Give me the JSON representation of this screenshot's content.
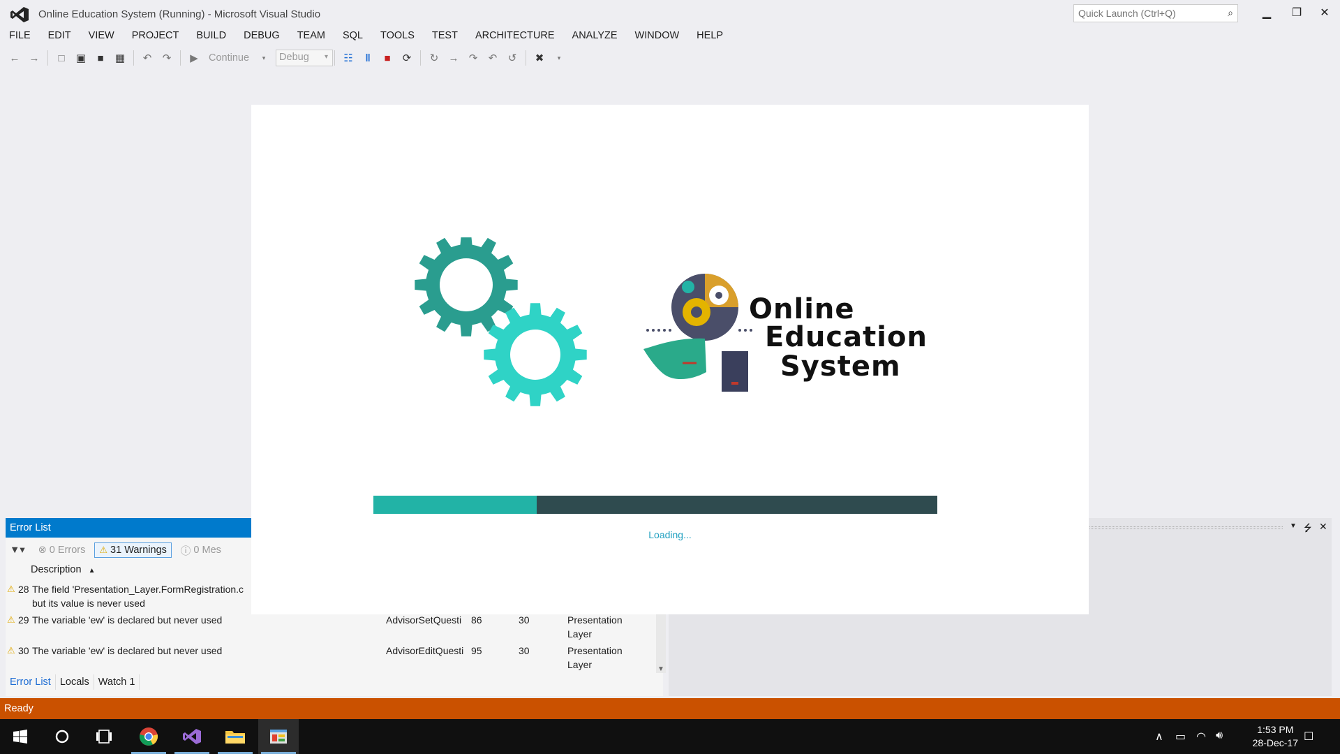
{
  "window": {
    "title": "Online Education System (Running) - Microsoft Visual Studio",
    "quick_launch_placeholder": "Quick Launch (Ctrl+Q)",
    "minimize": "▁",
    "restore": "❐",
    "close": "✕"
  },
  "menu": [
    "FILE",
    "EDIT",
    "VIEW",
    "PROJECT",
    "BUILD",
    "DEBUG",
    "TEAM",
    "SQL",
    "TOOLS",
    "TEST",
    "ARCHITECTURE",
    "ANALYZE",
    "WINDOW",
    "HELP"
  ],
  "toolbar": {
    "continue_label": "Continue",
    "config_value": "Debug"
  },
  "splash": {
    "logo_line1": "Online",
    "logo_line2": "Education",
    "logo_line3": "System",
    "progress_fraction": 0.29,
    "loading_text": "Loading...",
    "colors": {
      "gear_dark": "#2a9d8f",
      "gear_light": "#2fd3c6",
      "progress_fill": "#22b3a6",
      "progress_track": "#2f4b4f"
    }
  },
  "error_list": {
    "title": "Error List",
    "errors_label": "0 Errors",
    "warnings_label": "31 Warnings",
    "messages_label": "0 Mes",
    "column_description": "Description",
    "rows": [
      {
        "num": "28",
        "description": "The field 'Presentation_Layer.FormRegistration.c",
        "description2": "but its value is never used",
        "file": "",
        "line": "",
        "column": "",
        "project": "",
        "project2": ""
      },
      {
        "num": "29",
        "description": "The variable 'ew' is declared but never used",
        "description2": "",
        "file": "AdvisorSetQuesti",
        "line": "86",
        "column": "30",
        "project": "Presentation",
        "project2": "Layer"
      },
      {
        "num": "30",
        "description": "The variable 'ew' is declared but never used",
        "description2": "",
        "file": "AdvisorEditQuesti",
        "line": "95",
        "column": "30",
        "project": "Presentation",
        "project2": "Layer"
      }
    ],
    "tabs": [
      "Error List",
      "Locals",
      "Watch 1"
    ]
  },
  "status": {
    "text": "Ready"
  },
  "taskbar": {
    "time": "1:53 PM",
    "date": "28-Dec-17"
  }
}
